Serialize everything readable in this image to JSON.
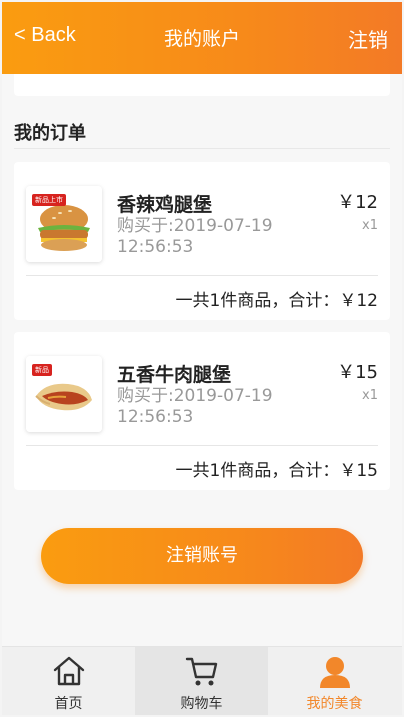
{
  "header": {
    "back_label": "< Back",
    "title": "我的账户",
    "logout_label": "注销"
  },
  "orders_section": {
    "title": "我的订单"
  },
  "orders": [
    {
      "name": "香辣鸡腿堡",
      "purchase_time": "购买于:2019-07-19 12:56:53",
      "price": "￥12",
      "quantity": "x1",
      "summary": "一共1件商品，合计：￥12",
      "image": "spicy-chicken-burger",
      "image_tag": "新品上市"
    },
    {
      "name": "五香牛肉腿堡",
      "purchase_time": "购买于:2019-07-19 12:56:53",
      "price": "￥15",
      "quantity": "x1",
      "summary": "一共1件商品，合计：￥15",
      "image": "beef-wrap",
      "image_tag": "新品"
    }
  ],
  "cancel_account_label": "注销账号",
  "tabbar": {
    "items": [
      {
        "label": "首页",
        "icon": "home-icon"
      },
      {
        "label": "购物车",
        "icon": "cart-icon"
      },
      {
        "label": "我的美食",
        "icon": "user-icon"
      }
    ]
  },
  "colors": {
    "accent": "#f78a1a",
    "accent_start": "#fa9c10",
    "accent_end": "#f37a26",
    "tab_selected": "#f2872a"
  }
}
